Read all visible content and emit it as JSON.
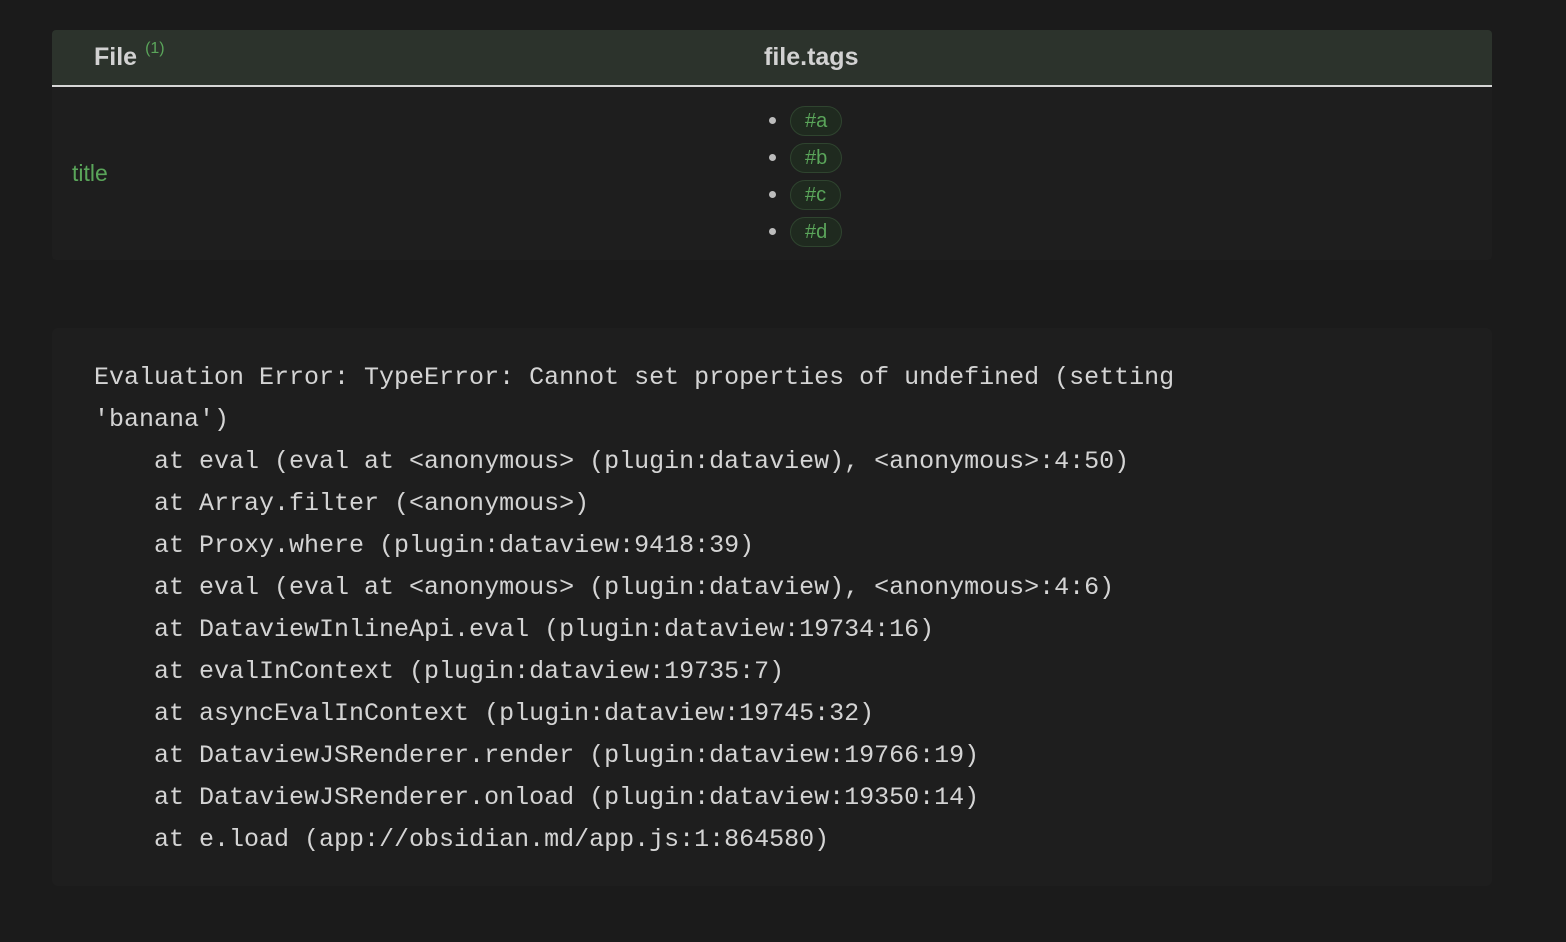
{
  "table": {
    "headers": {
      "file": "File",
      "file_count": "(1)",
      "tags": "file.tags"
    },
    "rows": [
      {
        "file": "title",
        "tags": [
          "#a",
          "#b",
          "#c",
          "#d"
        ]
      }
    ]
  },
  "error": {
    "lines": [
      "Evaluation Error: TypeError: Cannot set properties of undefined (setting",
      "'banana')",
      "    at eval (eval at <anonymous> (plugin:dataview), <anonymous>:4:50)",
      "    at Array.filter (<anonymous>)",
      "    at Proxy.where (plugin:dataview:9418:39)",
      "    at eval (eval at <anonymous> (plugin:dataview), <anonymous>:4:6)",
      "    at DataviewInlineApi.eval (plugin:dataview:19734:16)",
      "    at evalInContext (plugin:dataview:19735:7)",
      "    at asyncEvalInContext (plugin:dataview:19745:32)",
      "    at DataviewJSRenderer.render (plugin:dataview:19766:19)",
      "    at DataviewJSRenderer.onload (plugin:dataview:19350:14)",
      "    at e.load (app://obsidian.md/app.js:1:864580)"
    ]
  },
  "colors": {
    "accent": "#5aa55a",
    "header_bg": "#2c332c",
    "background": "#1b1b1b",
    "block_bg": "#1e1e1e",
    "text": "#d4d4d4"
  }
}
